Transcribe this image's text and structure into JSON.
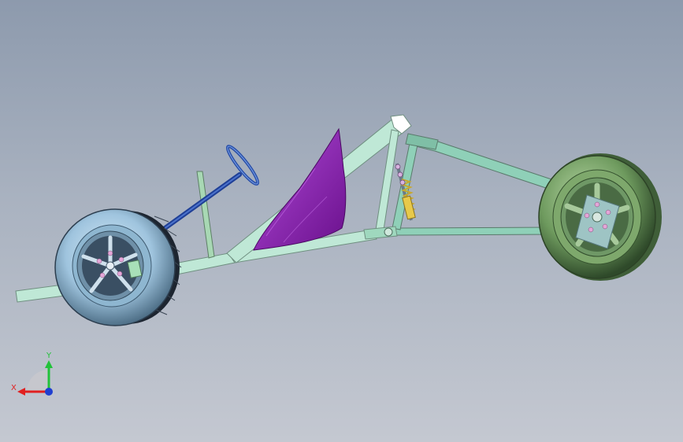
{
  "viewport": {
    "background_top": "#8d9aad",
    "background_bottom": "#c4c8d1"
  },
  "model": {
    "frame_color": "#bfe8d6",
    "seat_color": "#8a1fb0",
    "front_tire_color": "#9fc4de",
    "rear_tire_color": "#6e9a5e",
    "steering_color": "#2a4fa8",
    "shock_spring_color": "#e8c94a"
  },
  "triad": {
    "y_label": "Y",
    "x_label": "X",
    "y_color": "#22c23a",
    "x_color": "#e02020",
    "z_color": "#1f3fd0"
  }
}
